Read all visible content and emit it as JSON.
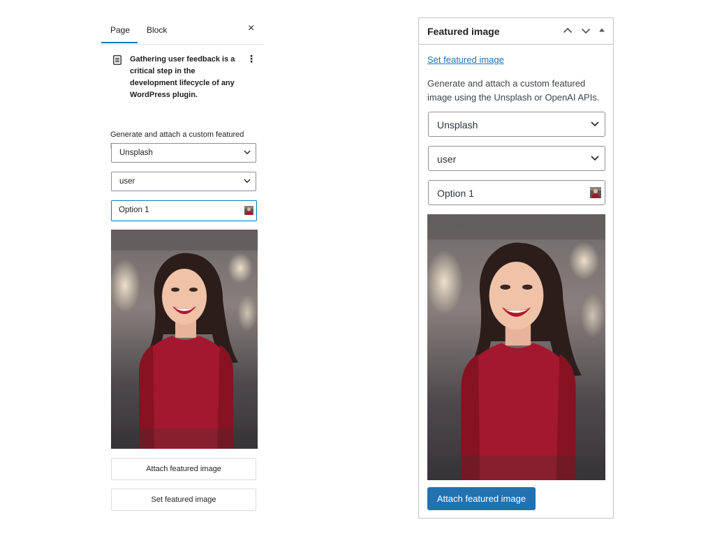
{
  "left_panel": {
    "tabs": [
      {
        "label": "Page",
        "active": true
      },
      {
        "label": "Block",
        "active": false
      }
    ],
    "close_label": "×",
    "post_title": "Gathering user feedback is a critical step in the development lifecycle of any WordPress plugin.",
    "more_menu_label": "⋮",
    "description": "Generate and attach a custom featured image using the Unsplash or OpenAI APIs.",
    "source_select": {
      "value": "Unsplash"
    },
    "query_select": {
      "value": "user"
    },
    "option_input": {
      "value": "Option 1"
    },
    "attach_button": "Attach featured image",
    "set_button": "Set featured image"
  },
  "right_panel": {
    "title": "Featured image",
    "set_link": "Set featured image",
    "description": "Generate and attach a custom featured image using the Unsplash or OpenAI APIs.",
    "source_select": {
      "value": "Unsplash"
    },
    "query_select": {
      "value": "user"
    },
    "option_input": {
      "value": "Option 1"
    },
    "attach_button": "Attach featured image"
  },
  "colors": {
    "accent": "#007cba",
    "wp_blue": "#2271b1",
    "link": "#2271b1",
    "dress_red": "#a3182e",
    "border": "#c3c4c7"
  },
  "icons": [
    "post-icon",
    "close-icon",
    "more-vertical-icon",
    "chevron-down-icon",
    "chevron-up-icon",
    "triangle-up-icon",
    "image-thumbnail-icon"
  ]
}
